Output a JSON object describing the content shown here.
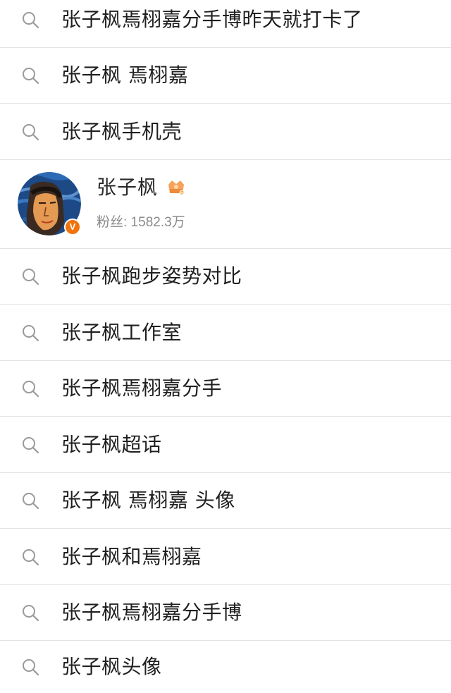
{
  "suggestions_top": [
    {
      "label": "张子枫焉栩嘉分手博昨天就打卡了",
      "icon": "search-icon"
    },
    {
      "label": "张子枫 焉栩嘉",
      "icon": "search-icon"
    },
    {
      "label": "张子枫手机壳",
      "icon": "search-icon"
    }
  ],
  "user_card": {
    "name": "张子枫",
    "badge_icon": "crown-badge-icon",
    "verified_mark": "V",
    "fans_label": "粉丝: 1582.3万",
    "accent_color": "#f2730a"
  },
  "suggestions_bottom": [
    {
      "label": "张子枫跑步姿势对比",
      "icon": "search-icon"
    },
    {
      "label": "张子枫工作室",
      "icon": "search-icon"
    },
    {
      "label": "张子枫焉栩嘉分手",
      "icon": "search-icon"
    },
    {
      "label": "张子枫超话",
      "icon": "search-icon"
    },
    {
      "label": "张子枫 焉栩嘉 头像",
      "icon": "search-icon"
    },
    {
      "label": "张子枫和焉栩嘉",
      "icon": "search-icon"
    },
    {
      "label": "张子枫焉栩嘉分手博",
      "icon": "search-icon"
    },
    {
      "label": "张子枫头像",
      "icon": "search-icon"
    }
  ]
}
